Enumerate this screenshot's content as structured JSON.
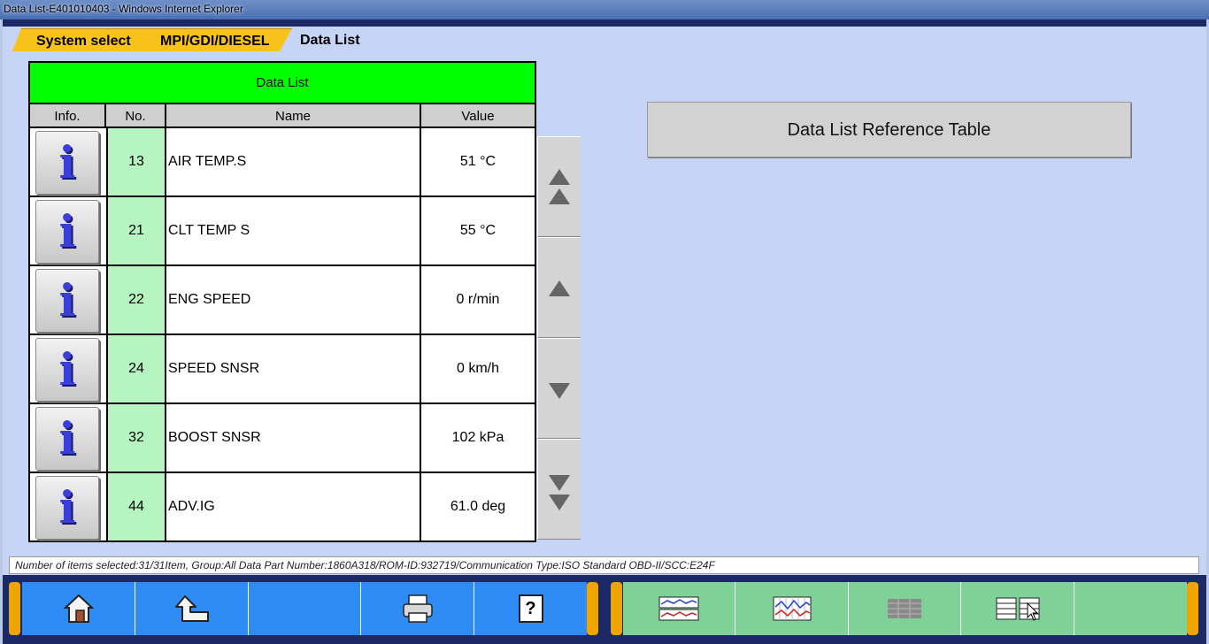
{
  "window": {
    "title": "Data List-E401010403 - Windows Internet Explorer"
  },
  "breadcrumb": {
    "item1": "System select",
    "item2": "MPI/GDI/DIESEL",
    "current": "Data List"
  },
  "table": {
    "title": "Data List",
    "columns": {
      "info": "Info.",
      "no": "No.",
      "name": "Name",
      "value": "Value"
    },
    "info_glyph": "i",
    "rows": [
      {
        "no": "13",
        "name": "AIR TEMP.S",
        "value": "51 °C"
      },
      {
        "no": "21",
        "name": "CLT TEMP S",
        "value": "55 °C"
      },
      {
        "no": "22",
        "name": "ENG SPEED",
        "value": "0 r/min"
      },
      {
        "no": "24",
        "name": "SPEED SNSR",
        "value": "0 km/h"
      },
      {
        "no": "32",
        "name": "BOOST SNSR",
        "value": "102 kPa"
      },
      {
        "no": "44",
        "name": "ADV.IG",
        "value": "61.0 deg"
      }
    ]
  },
  "reference_button": {
    "label": "Data List Reference Table"
  },
  "status": {
    "text": "Number of items selected:31/31Item, Group:All Data Part Number:1860A318/ROM-ID:932719/Communication Type:ISO Standard OBD-II/SCC:E24F"
  },
  "toolbar": {
    "left": [
      "home-icon",
      "back-icon",
      "",
      "printer-icon",
      "help-icon"
    ],
    "right": [
      "graph-icon",
      "graph-grid-icon",
      "table-icon",
      "list-select-icon",
      ""
    ],
    "help_glyph": "?"
  },
  "colors": {
    "header_green": "#00ff00",
    "number_cell": "#b6f5c2",
    "toolbar_blue": "#2f8cf5",
    "toolbar_green": "#7fd197",
    "crumb_yellow": "#f7c21a"
  }
}
